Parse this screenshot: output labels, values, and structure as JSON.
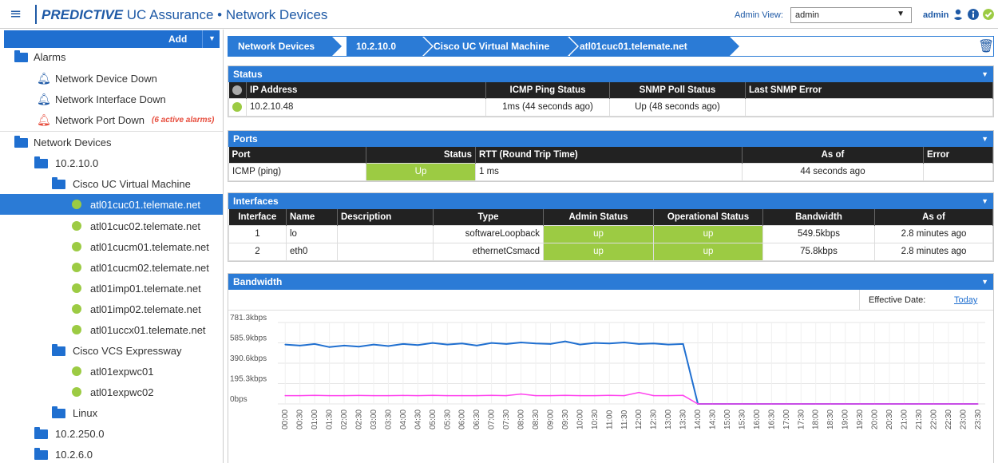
{
  "header": {
    "brand_bold": "PREDICTIVE",
    "brand_rest": "UC Assurance",
    "separator": "•",
    "page": "Network Devices",
    "admin_view_label": "Admin View:",
    "admin_view_value": "admin",
    "user": "admin"
  },
  "sidebar": {
    "add_label": "Add",
    "alarms_label": "Alarms",
    "alarm_items": [
      "Network Device Down",
      "Network Interface Down",
      "Network Port Down"
    ],
    "alarm_badge": "(6 active alarms)",
    "devices_label": "Network Devices",
    "subnet1": "10.2.10.0",
    "group1": "Cisco UC Virtual Machine",
    "group1_items": [
      "atl01cuc01.telemate.net",
      "atl01cuc02.telemate.net",
      "atl01cucm01.telemate.net",
      "atl01cucm02.telemate.net",
      "atl01imp01.telemate.net",
      "atl01imp02.telemate.net",
      "atl01uccx01.telemate.net"
    ],
    "group2": "Cisco VCS Expressway",
    "group2_items": [
      "atl01expwc01",
      "atl01expwc02"
    ],
    "group3": "Linux",
    "subnet2": "10.2.250.0",
    "subnet3": "10.2.6.0"
  },
  "breadcrumb": [
    "Network Devices",
    "10.2.10.0",
    "Cisco UC Virtual Machine",
    "atl01cuc01.telemate.net"
  ],
  "status": {
    "title": "Status",
    "headers": [
      "IP Address",
      "ICMP Ping Status",
      "SNMP Poll Status",
      "Last SNMP Error"
    ],
    "row": {
      "ip": "10.2.10.48",
      "icmp": "1ms (44 seconds ago)",
      "snmp": "Up (48 seconds ago)",
      "error": ""
    }
  },
  "ports": {
    "title": "Ports",
    "headers": [
      "Port",
      "Status",
      "RTT (Round Trip Time)",
      "As of",
      "Error"
    ],
    "row": {
      "port": "ICMP (ping)",
      "status": "Up",
      "rtt": "1 ms",
      "asof": "44 seconds ago",
      "error": ""
    }
  },
  "interfaces": {
    "title": "Interfaces",
    "headers": [
      "Interface",
      "Name",
      "Description",
      "Type",
      "Admin Status",
      "Operational Status",
      "Bandwidth",
      "As of"
    ],
    "rows": [
      {
        "iface": "1",
        "name": "lo",
        "desc": "",
        "type": "softwareLoopback",
        "admin": "up",
        "oper": "up",
        "bw": "549.5kbps",
        "asof": "2.8 minutes ago"
      },
      {
        "iface": "2",
        "name": "eth0",
        "desc": "",
        "type": "ethernetCsmacd",
        "admin": "up",
        "oper": "up",
        "bw": "75.8kbps",
        "asof": "2.8 minutes ago"
      }
    ]
  },
  "bandwidth": {
    "title": "Bandwidth",
    "effective_label": "Effective Date:",
    "today_label": "Today"
  },
  "colors": {
    "accent": "#2b7bd6",
    "ok": "#9ccb43",
    "alarm": "#e74c3c",
    "blue_series": "#1f6fd0",
    "magenta_series": "#ff44ee"
  },
  "chart_data": {
    "type": "line",
    "ylabels": [
      "781.3kbps",
      "585.9kbps",
      "390.6kbps",
      "195.3kbps",
      "0bps"
    ],
    "yticks": [
      781.3,
      585.9,
      390.6,
      195.3,
      0
    ],
    "ylim": [
      0,
      781.3
    ],
    "x": [
      "00:00",
      "00:30",
      "01:00",
      "01:30",
      "02:00",
      "02:30",
      "03:00",
      "03:30",
      "04:00",
      "04:30",
      "05:00",
      "05:30",
      "06:00",
      "06:30",
      "07:00",
      "07:30",
      "08:00",
      "08:30",
      "09:00",
      "09:30",
      "10:00",
      "10:30",
      "11:00",
      "11:30",
      "12:00",
      "12:30",
      "13:00",
      "13:30",
      "14:00",
      "14:30",
      "15:00",
      "15:30",
      "16:00",
      "16:30",
      "17:00",
      "17:30",
      "18:00",
      "18:30",
      "19:00",
      "19:30",
      "20:00",
      "20:30",
      "21:00",
      "21:30",
      "22:00",
      "22:30",
      "23:00",
      "23:30"
    ],
    "series": [
      {
        "color": "#1f6fd0",
        "values": [
          570,
          560,
          575,
          545,
          560,
          550,
          570,
          555,
          575,
          565,
          585,
          570,
          580,
          560,
          585,
          575,
          590,
          580,
          575,
          600,
          570,
          585,
          580,
          590,
          575,
          580,
          570,
          575,
          0,
          0,
          0,
          0,
          0,
          0,
          0,
          0,
          0,
          0,
          0,
          0,
          0,
          0,
          0,
          0,
          0,
          0,
          0,
          0
        ]
      },
      {
        "color": "#ff44ee",
        "values": [
          80,
          80,
          82,
          80,
          80,
          81,
          80,
          80,
          81,
          80,
          82,
          80,
          80,
          80,
          82,
          80,
          95,
          80,
          80,
          82,
          80,
          80,
          82,
          80,
          110,
          80,
          80,
          82,
          0,
          0,
          0,
          0,
          0,
          0,
          0,
          0,
          0,
          0,
          0,
          0,
          0,
          0,
          0,
          0,
          0,
          0,
          0,
          0
        ]
      }
    ],
    "grid": true
  }
}
